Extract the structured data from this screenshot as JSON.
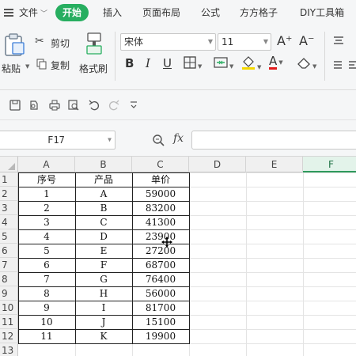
{
  "menu": {
    "file": "文件",
    "tabs": [
      {
        "label": "开始",
        "active": true
      },
      {
        "label": "插入",
        "active": false
      },
      {
        "label": "页面布局",
        "active": false
      },
      {
        "label": "公式",
        "active": false
      },
      {
        "label": "方方格子",
        "active": false
      },
      {
        "label": "DIY工具箱",
        "active": false
      }
    ]
  },
  "ribbon": {
    "cut": "剪切",
    "paste": "粘贴",
    "copy": "复制",
    "format_painter": "格式刷",
    "font_name": "宋体",
    "font_size": "11",
    "grow_font": "A⁺",
    "shrink_font": "A⁻"
  },
  "formula_bar": {
    "name_box": "F17",
    "fx_label": "fx",
    "formula": ""
  },
  "sheet": {
    "columns": [
      "A",
      "B",
      "C",
      "D",
      "E",
      "F"
    ],
    "selected_column": "F",
    "rows": [
      "1",
      "2",
      "3",
      "4",
      "5",
      "6",
      "7",
      "8",
      "9",
      "10",
      "11",
      "12",
      "13"
    ],
    "header": [
      "序号",
      "产品",
      "单价"
    ],
    "data": [
      [
        "1",
        "A",
        "59000"
      ],
      [
        "2",
        "B",
        "83200"
      ],
      [
        "3",
        "C",
        "41300"
      ],
      [
        "4",
        "D",
        "23900"
      ],
      [
        "5",
        "E",
        "27200"
      ],
      [
        "6",
        "F",
        "68700"
      ],
      [
        "7",
        "G",
        "76400"
      ],
      [
        "8",
        "H",
        "56000"
      ],
      [
        "9",
        "I",
        "81700"
      ],
      [
        "10",
        "J",
        "15100"
      ],
      [
        "11",
        "K",
        "19900"
      ]
    ]
  },
  "colors": {
    "accent": "#27ae60",
    "selected_header": "#e3f3ea",
    "table_border": "#222222"
  }
}
